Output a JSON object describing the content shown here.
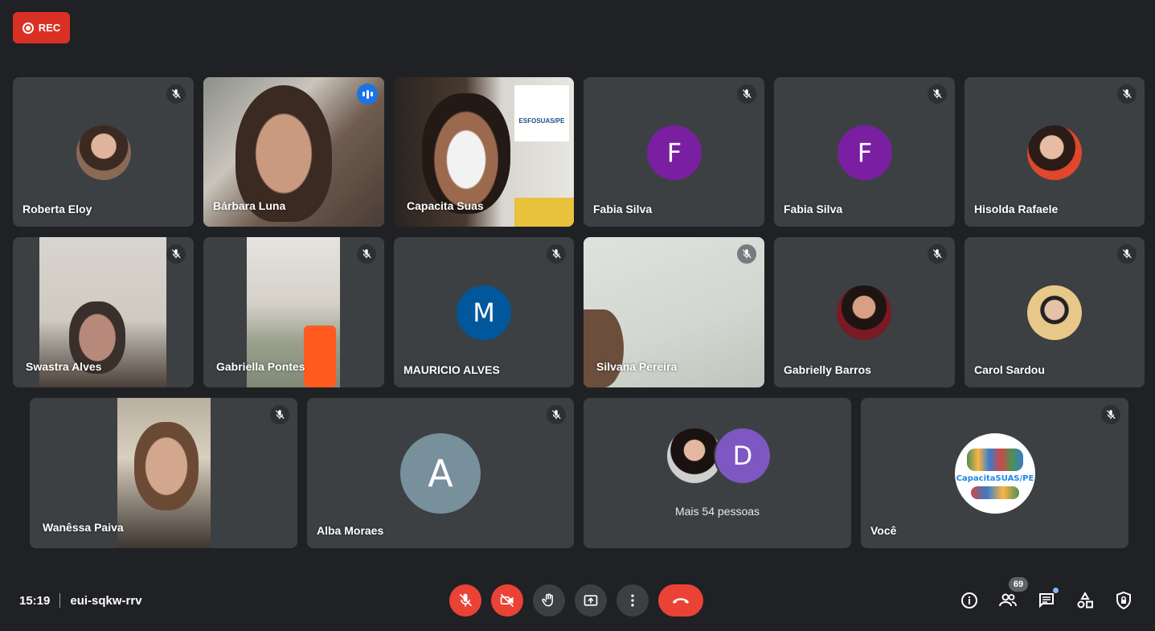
{
  "recording": {
    "label": "REC"
  },
  "participants": [
    {
      "name": "Roberta Eloy",
      "type": "photo-avatar",
      "muted": true
    },
    {
      "name": "Bárbara Luna",
      "type": "video",
      "speaking": true
    },
    {
      "name": "Capacita Suas",
      "type": "video",
      "muted": false,
      "background_text": "ESFOSUAS/PE"
    },
    {
      "name": "Fabia Silva",
      "type": "initial",
      "initial": "F",
      "color": "#7b1fa2",
      "muted": true
    },
    {
      "name": "Fabia Silva",
      "type": "initial",
      "initial": "F",
      "color": "#7b1fa2",
      "muted": true
    },
    {
      "name": "Hisolda Rafaele",
      "type": "photo-avatar",
      "muted": true
    },
    {
      "name": "Swastra Alves",
      "type": "video",
      "muted": true
    },
    {
      "name": "Gabriella Pontes",
      "type": "video",
      "muted": true
    },
    {
      "name": "MAURICIO ALVES",
      "type": "initial",
      "initial": "M",
      "color": "#01579b",
      "muted": true
    },
    {
      "name": "Silvana Pereira",
      "type": "video",
      "muted": true
    },
    {
      "name": "Gabrielly Barros",
      "type": "photo-avatar",
      "muted": true
    },
    {
      "name": "Carol Sardou",
      "type": "photo-avatar",
      "muted": true
    },
    {
      "name": "Wanêssa Paiva",
      "type": "video",
      "muted": true
    },
    {
      "name": "Alba Moraes",
      "type": "initial",
      "initial": "A",
      "color": "#78909c",
      "muted": true
    },
    {
      "name": "Você",
      "type": "logo-avatar",
      "logo_text": "CapacitaSUAS/PE",
      "muted": true
    }
  ],
  "more_people": {
    "label": "Mais 54 pessoas",
    "initial": "D",
    "initial_color": "#7e57c2"
  },
  "meeting": {
    "time": "15:19",
    "code": "eui-sqkw-rrv"
  },
  "controls": [
    "mic-off",
    "camera-off",
    "raise-hand",
    "present",
    "more-options",
    "leave-call"
  ],
  "right_controls": {
    "people_count": "69",
    "icons": [
      "info",
      "people",
      "chat",
      "activities",
      "host-controls"
    ]
  }
}
